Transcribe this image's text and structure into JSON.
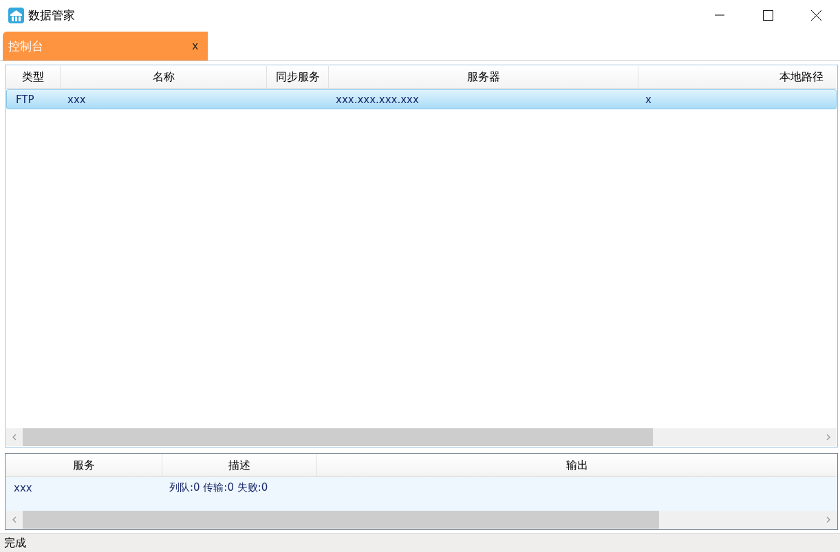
{
  "window": {
    "title": "数据管家"
  },
  "tabs": [
    {
      "label": "控制台",
      "close": "x",
      "selected": true
    }
  ],
  "connections_table": {
    "columns": [
      "类型",
      "名称",
      "同步服务",
      "服务器",
      "本地路径"
    ],
    "rows": [
      {
        "cells": [
          "FTP",
          "xxx",
          "",
          "xxx.xxx.xxx.xxx",
          "x"
        ],
        "selected": true
      }
    ]
  },
  "services_table": {
    "columns": [
      "服务",
      "描述",
      "输出"
    ],
    "rows": [
      {
        "cells": [
          "xxx",
          "列队:0 传输:0 失败:0",
          ""
        ],
        "selected": false
      }
    ]
  },
  "status_bar": "完成"
}
